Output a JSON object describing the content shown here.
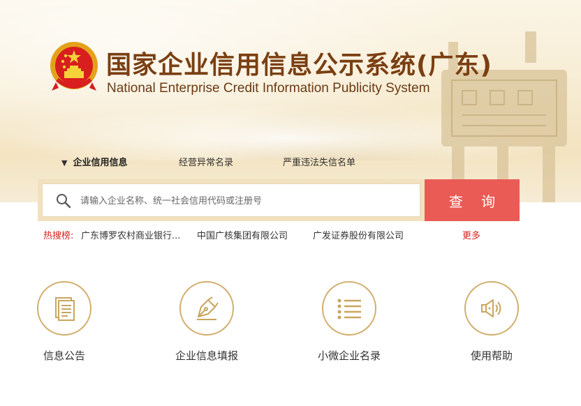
{
  "header": {
    "title": "国家企业信用信息公示系统(广东)",
    "subtitle": "National Enterprise Credit Information Publicity System",
    "emblem_icon": "national-emblem-icon"
  },
  "tabs": [
    {
      "label": "企业信用信息",
      "active": true
    },
    {
      "label": "经营异常名录",
      "active": false
    },
    {
      "label": "严重违法失信名单",
      "active": false
    }
  ],
  "search": {
    "placeholder": "请输入企业名称、统一社会信用代码或注册号",
    "value": "",
    "button_label": "查 询"
  },
  "hot_search": {
    "label": "热搜榜:",
    "items": [
      "广东博罗农村商业银行...",
      "中国广核集团有限公司",
      "广发证券股份有限公司"
    ],
    "more_label": "更多"
  },
  "services": [
    {
      "label": "信息公告",
      "icon": "document-icon"
    },
    {
      "label": "企业信息填报",
      "icon": "pen-nib-icon"
    },
    {
      "label": "小微企业名录",
      "icon": "list-icon"
    },
    {
      "label": "使用帮助",
      "icon": "speaker-icon"
    }
  ],
  "colors": {
    "title": "#7a3f12",
    "accent_red": "#ea5b55",
    "hot_red": "#d6241e",
    "gold": "#d1ae6c"
  }
}
